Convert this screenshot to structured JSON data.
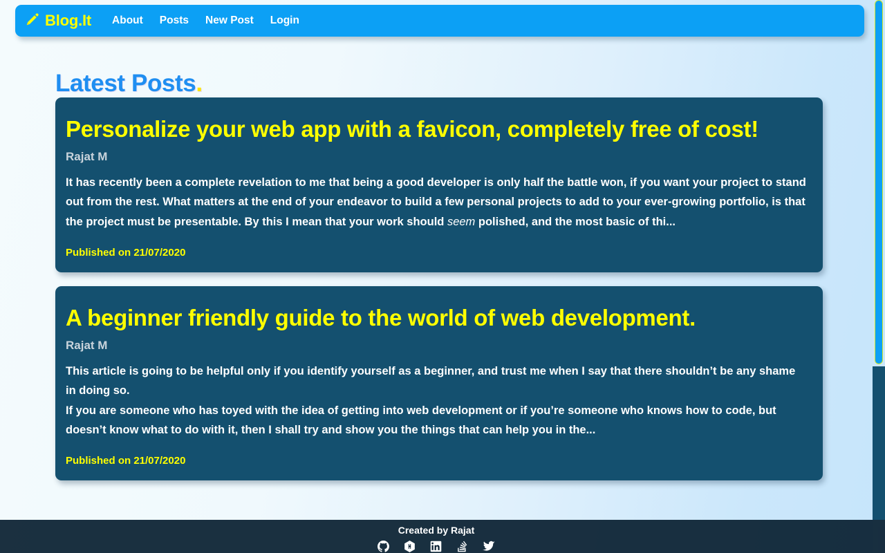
{
  "navbar": {
    "brand": "Blog.It",
    "brand_icon": "pen-icon",
    "accent_color": "#0ca0f5",
    "brand_color": "#ffff00",
    "links": [
      {
        "label": "About"
      },
      {
        "label": "Posts"
      },
      {
        "label": "New Post"
      },
      {
        "label": "Login"
      }
    ]
  },
  "main": {
    "heading": "Latest Posts",
    "heading_dot": ".",
    "heading_color": "#1f8ef1",
    "card_color": "#14506f",
    "title_color": "#ffff00",
    "posts": [
      {
        "title": "Personalize your web app with a favicon, completely free of cost!",
        "author": "Rajat M",
        "body_part1": "It has recently been a complete revelation to me that being a good developer is only half the battle won, if you want your project to stand out from the rest. What matters at the end of your endeavor to build a few personal projects to add to your ever-growing portfolio, is that the project must be presentable. By this I mean that your work should ",
        "body_italic": "seem",
        "body_part2": " polished, and the most basic of thi...",
        "date": "Published on 21/07/2020"
      },
      {
        "title": "A beginner friendly guide to the world of web development.",
        "author": "Rajat M",
        "body_part1": "This article is going to be helpful only if you identify yourself as a beginner, and trust me when I say that there shouldn’t be any shame in doing so.",
        "body_part2": "If you are someone who has toyed with the idea of getting into web development or if you’re someone who knows how to code, but doesn’t know what to do with it, then I shall try and show you the things that can help you in the...",
        "date": "Published on 21/07/2020"
      }
    ]
  },
  "footer": {
    "text": "Created by Rajat",
    "icons": [
      {
        "name": "github-icon"
      },
      {
        "name": "hackerrank-icon"
      },
      {
        "name": "linkedin-icon"
      },
      {
        "name": "stackoverflow-icon"
      },
      {
        "name": "twitter-icon"
      }
    ]
  },
  "scrollbar": {
    "thumb_color": "#0ca0f5",
    "thumb_border_color": "#d4e82a",
    "track_color": "#cbe7fb"
  }
}
